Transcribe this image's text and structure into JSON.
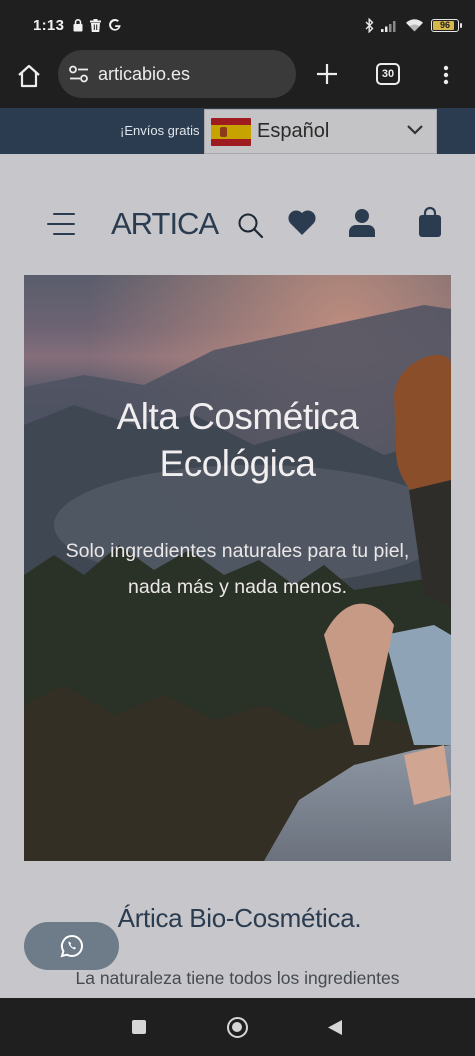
{
  "status_bar": {
    "time": "1:13",
    "left_icons": [
      "lock-icon",
      "trash-icon",
      "google-icon"
    ],
    "right_icons": [
      "bluetooth-icon",
      "signal-icon",
      "wifi-icon"
    ],
    "battery_level": "96"
  },
  "browser": {
    "url": "articabio.es",
    "tab_count": "30"
  },
  "announce": {
    "text": "¡Envíos gratis"
  },
  "language_select": {
    "selected": "Español",
    "flag": "spain-flag-icon"
  },
  "header": {
    "logo": "ARTICA"
  },
  "hero": {
    "title_line1": "Alta Cosmética",
    "title_line2": "Ecológica",
    "subtitle_line1": "Solo ingredientes naturales para tu piel,",
    "subtitle_line2": "nada más y nada menos."
  },
  "section": {
    "title": "Ártica Bio-Cosmética.",
    "text": "La naturaleza tiene todos los ingredientes"
  },
  "colors": {
    "brand_navy": "#2b3c50",
    "page_bg": "#c7c7cb",
    "whatsapp_button": "#6e7b89"
  }
}
